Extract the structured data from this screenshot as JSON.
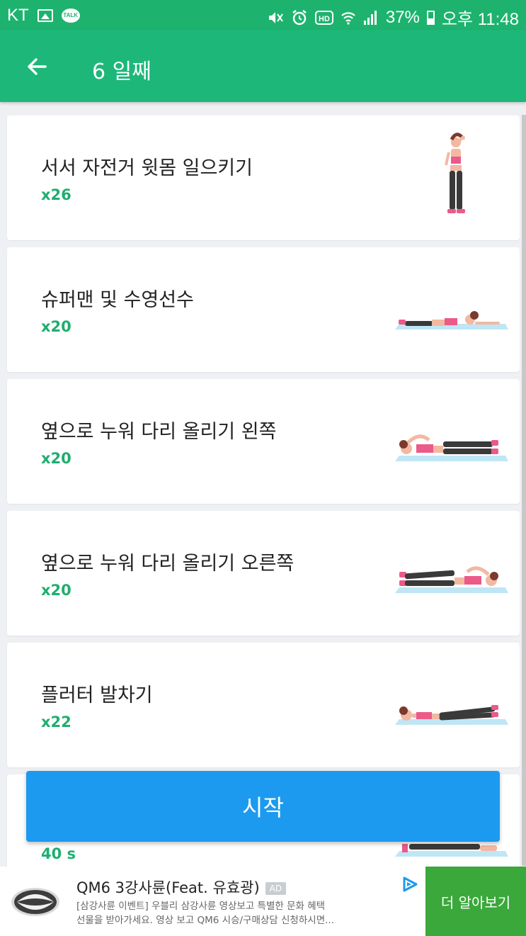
{
  "status_bar": {
    "carrier": "KT",
    "talk_label": "TALK",
    "battery": "37%",
    "time": "오후 11:48",
    "icons": [
      "gallery-icon",
      "kakaotalk-icon",
      "mute-icon",
      "alarm-icon",
      "hd-icon",
      "wifi-icon",
      "signal-icon",
      "battery-icon"
    ]
  },
  "app_bar": {
    "title": "6 일째",
    "back_icon": "arrow-left-icon",
    "color": "#1db879"
  },
  "exercises": [
    {
      "name": "서서 자전거 윗몸 일으키기",
      "reps": "x26",
      "illustration": "standing-bicycle-crunch"
    },
    {
      "name": "슈퍼맨 및 수영선수",
      "reps": "x20",
      "illustration": "superman-swimmer"
    },
    {
      "name": "옆으로 누워 다리 올리기 왼쪽",
      "reps": "x20",
      "illustration": "side-leg-lift-left"
    },
    {
      "name": "옆으로 누워 다리 올리기 오른쪽",
      "reps": "x20",
      "illustration": "side-leg-lift-right"
    },
    {
      "name": "플러터 발차기",
      "reps": "x22",
      "illustration": "flutter-kicks"
    },
    {
      "name": "",
      "reps": "40 s",
      "illustration": "plank"
    }
  ],
  "start_button": {
    "label": "시작",
    "color": "#1c9af0"
  },
  "ad": {
    "title": "QM6 3강사륜(Feat. 유효광)",
    "badge": "AD",
    "description_line1": "[삼강사륜 이벤트] 우블리 삼강사륜 영상보고 특별한 문화 혜택",
    "description_line2": "선물을 받아가세요. 영상 보고 QM6 시승/구매상담 신청하시면...",
    "cta": "더 알아보기",
    "cta_color": "#3aa83a"
  }
}
